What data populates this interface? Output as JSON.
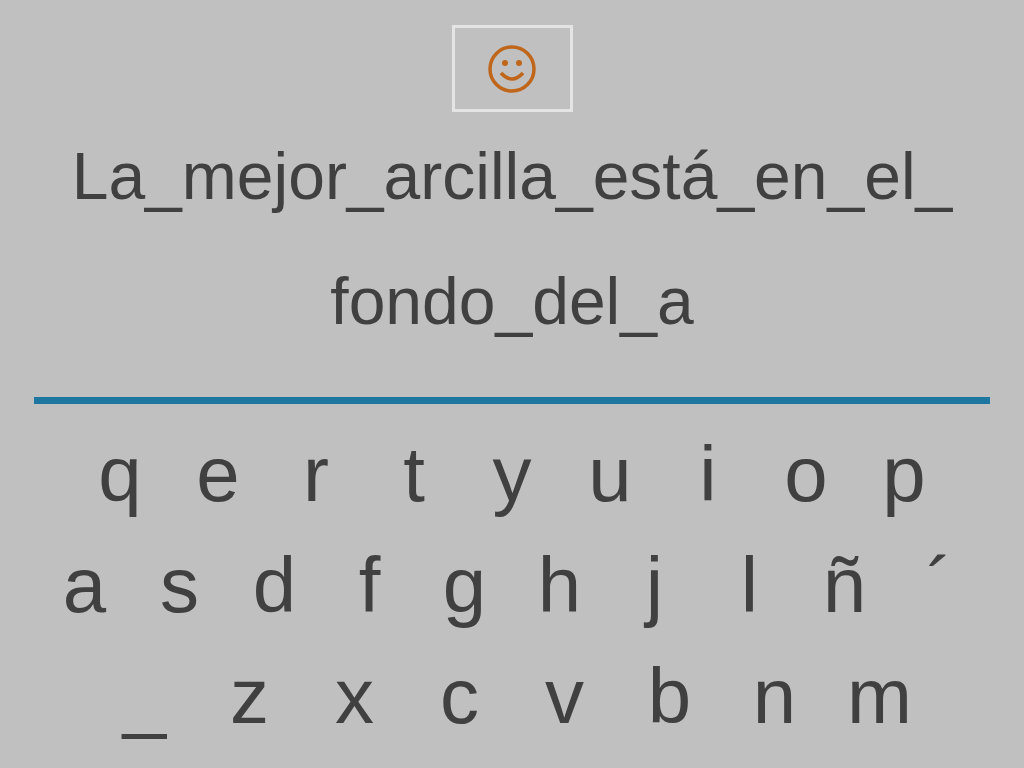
{
  "phrase_lines": [
    "La_mejor_arcilla_está_en_el_",
    "fondo_del_a"
  ],
  "keyboard": {
    "rows": [
      {
        "keys": [
          "q",
          "e",
          "r",
          "t",
          "y",
          "u",
          "i",
          "o",
          "p"
        ]
      },
      {
        "keys": [
          "a",
          "s",
          "d",
          "f",
          "g",
          "h",
          "j",
          "l",
          "ñ",
          "´"
        ]
      },
      {
        "keys": [
          "_",
          "z",
          "x",
          "c",
          "v",
          "b",
          "n",
          "m"
        ]
      }
    ]
  }
}
